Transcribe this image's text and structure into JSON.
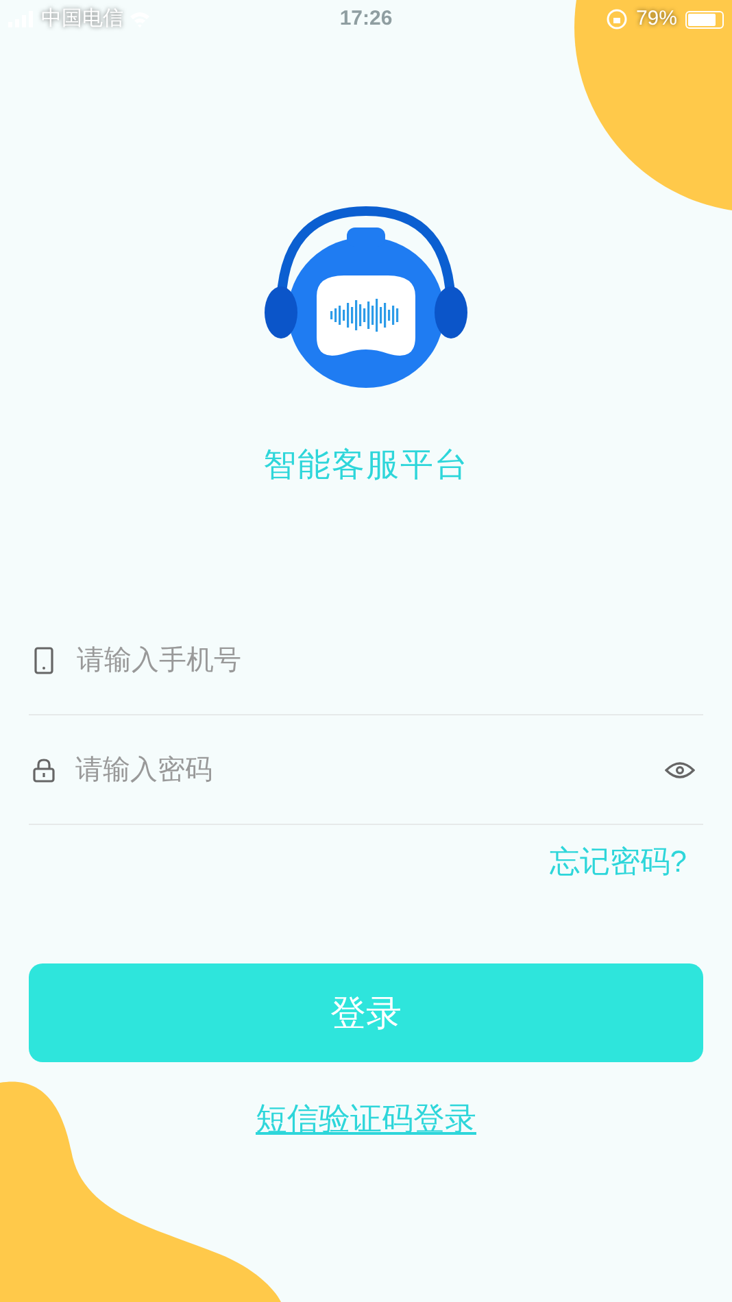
{
  "status_bar": {
    "carrier": "中国电信",
    "time": "17:26",
    "battery_percent": "79%"
  },
  "app_title": "智能客服平台",
  "phone_field": {
    "placeholder": "请输入手机号"
  },
  "password_field": {
    "placeholder": "请输入密码",
    "show_password": false
  },
  "forgot_password": "忘记密码?",
  "login_button": "登录",
  "sms_login_link": "短信验证码登录"
}
